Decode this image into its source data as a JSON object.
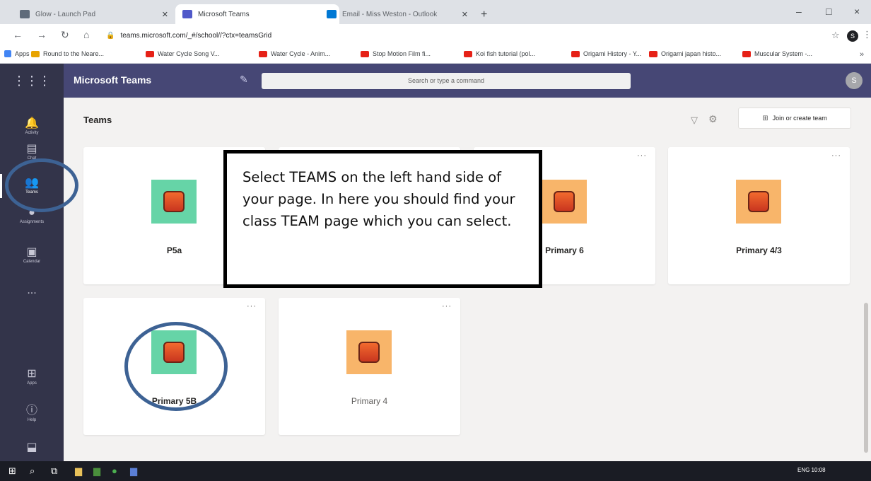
{
  "browser": {
    "tabs": [
      {
        "label": "Glow - Launch Pad",
        "active": false,
        "favicon_color": "#5f6b7a"
      },
      {
        "label": "Microsoft Teams",
        "active": true,
        "favicon_color": "#5059c9"
      },
      {
        "label": "Email - Miss Weston - Outlook",
        "active": false,
        "favicon_color": "#0078d4"
      }
    ],
    "new_tab": "+",
    "window_controls": {
      "minimize": "–",
      "maximize": "□",
      "close": "×"
    },
    "url": "teams.microsoft.com/_#/school//?ctx=teamsGrid",
    "profile_initial": "S",
    "bookmarks": [
      {
        "label": "Apps",
        "color": "#4285f4"
      },
      {
        "label": "Round to the Neare...",
        "color": "#e8a400"
      },
      {
        "label": "Water Cycle Song V...",
        "color": "#e62117"
      },
      {
        "label": "Water Cycle - Anim...",
        "color": "#e62117"
      },
      {
        "label": "Stop Motion Film fi...",
        "color": "#e62117"
      },
      {
        "label": "Koi fish tutorial (pol...",
        "color": "#e62117"
      },
      {
        "label": "Origami History - Y...",
        "color": "#e62117"
      },
      {
        "label": "Origami japan histo...",
        "color": "#e62117"
      },
      {
        "label": "Muscular System -...",
        "color": "#e62117"
      }
    ]
  },
  "header": {
    "app_title": "Microsoft Teams",
    "search_placeholder": "Search or type a command",
    "avatar_initial": "S"
  },
  "rail": {
    "items": [
      {
        "label": "Activity",
        "icon": "bell-icon"
      },
      {
        "label": "Chat",
        "icon": "chat-icon"
      },
      {
        "label": "Teams",
        "icon": "teams-icon",
        "active": true
      },
      {
        "label": "Assignments",
        "icon": "assignments-icon"
      },
      {
        "label": "Calendar",
        "icon": "calendar-icon"
      },
      {
        "label": "...",
        "icon": "more-icon"
      }
    ],
    "bottom_items": [
      {
        "label": "Apps",
        "icon": "apps-icon"
      },
      {
        "label": "Help",
        "icon": "help-icon"
      },
      {
        "label": "",
        "icon": "download-icon"
      }
    ]
  },
  "main": {
    "title": "Teams",
    "join_label": "Join or create team",
    "cards": [
      {
        "name": "P5a",
        "tile_color": "#66d4a7"
      },
      {
        "name": "",
        "tile_color": "#66d4a7"
      },
      {
        "name": "Primary 6",
        "tile_color": "#f8b56a"
      },
      {
        "name": "Primary 4/3",
        "tile_color": "#f8b56a"
      },
      {
        "name": "Primary 5B",
        "tile_color": "#66d4a7"
      },
      {
        "name": "Primary 4",
        "tile_color": "#f8b56a"
      }
    ],
    "more_label": "···"
  },
  "callout": {
    "text": "Select TEAMS on the left hand side of your page. In here you should find your class TEAM page which you can select."
  },
  "colors": {
    "teams_purple": "#464775",
    "rail_dark": "#33344a",
    "annotation_ring": "#3d6294"
  },
  "taskbar": {
    "tray_text": "ENG  10:08"
  }
}
